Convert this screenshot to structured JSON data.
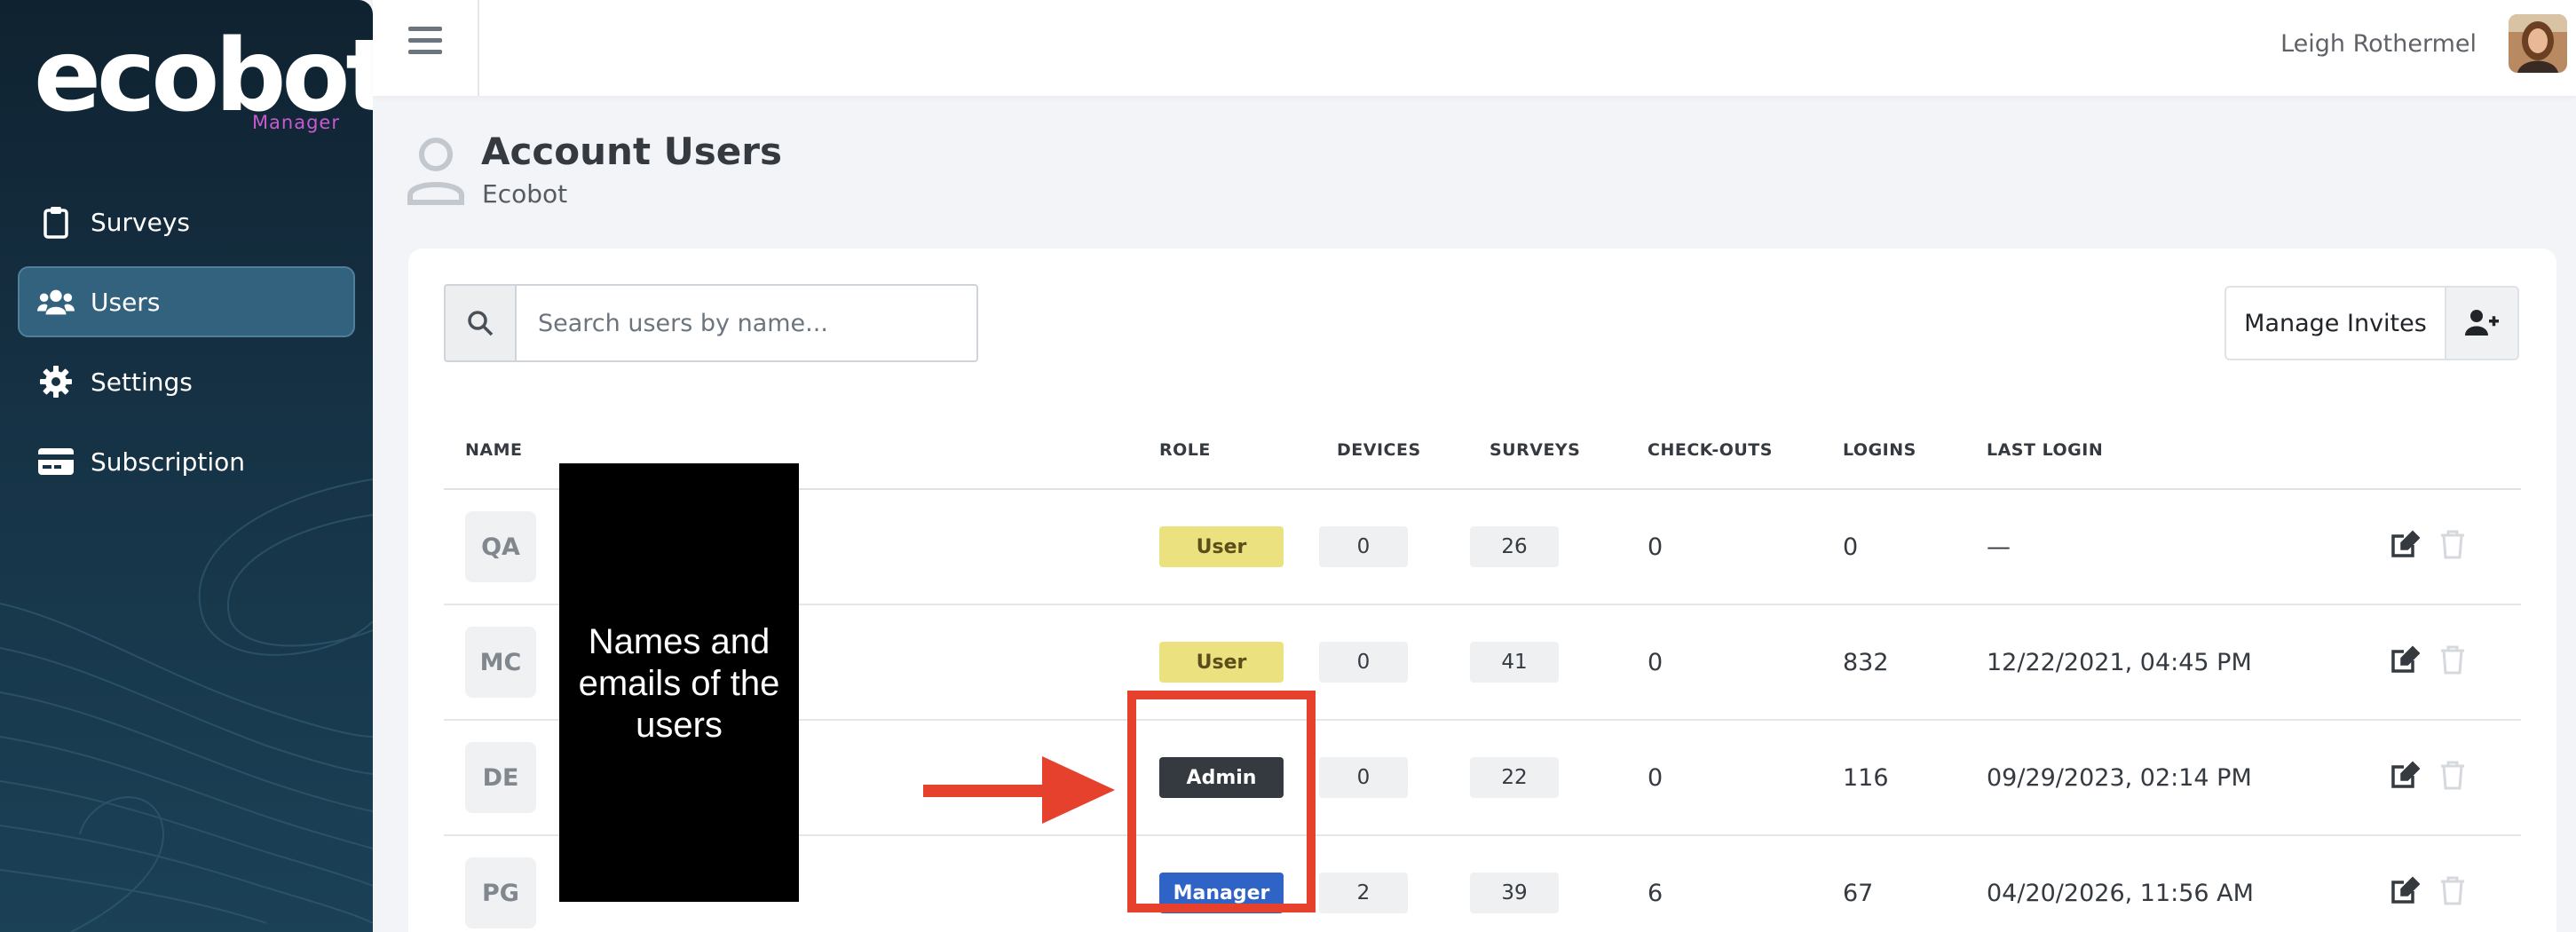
{
  "brand": {
    "name": "ecobot",
    "subtitle": "Manager",
    "accent": "#c65bd0"
  },
  "sidebar": {
    "items": [
      {
        "label": "Surveys",
        "icon": "clipboard-icon",
        "active": false
      },
      {
        "label": "Users",
        "icon": "users-icon",
        "active": true
      },
      {
        "label": "Settings",
        "icon": "gear-icon",
        "active": false
      },
      {
        "label": "Subscription",
        "icon": "credit-card-icon",
        "active": false
      }
    ]
  },
  "topbar": {
    "user_name": "Leigh Rothermel"
  },
  "page": {
    "title": "Account Users",
    "subtitle": "Ecobot"
  },
  "search": {
    "placeholder": "Search users by name...",
    "value": ""
  },
  "invites": {
    "label": "Manage Invites"
  },
  "table": {
    "columns": [
      "NAME",
      "ROLE",
      "DEVICES",
      "SURVEYS",
      "CHECK-OUTS",
      "LOGINS",
      "LAST LOGIN"
    ],
    "rows": [
      {
        "initials": "QA",
        "role": "User",
        "devices": "0",
        "surveys": "26",
        "checkouts": "0",
        "logins": "0",
        "last_login": "—"
      },
      {
        "initials": "MC",
        "role": "User",
        "devices": "0",
        "surveys": "41",
        "checkouts": "0",
        "logins": "832",
        "last_login": "12/22/2021, 04:45 PM"
      },
      {
        "initials": "DE",
        "role": "Admin",
        "devices": "0",
        "surveys": "22",
        "checkouts": "0",
        "logins": "116",
        "last_login": "09/29/2023, 02:14 PM"
      },
      {
        "initials": "PG",
        "role": "Manager",
        "devices": "2",
        "surveys": "39",
        "checkouts": "6",
        "logins": "67",
        "last_login": "04/20/2026, 11:56 AM"
      }
    ]
  },
  "annotation": {
    "redaction_text": "Names and emails of the users",
    "highlight_color": "#e5412d"
  },
  "colors": {
    "role_user": "#ece17f",
    "role_admin": "#343a40",
    "role_manager": "#2f63c5"
  }
}
